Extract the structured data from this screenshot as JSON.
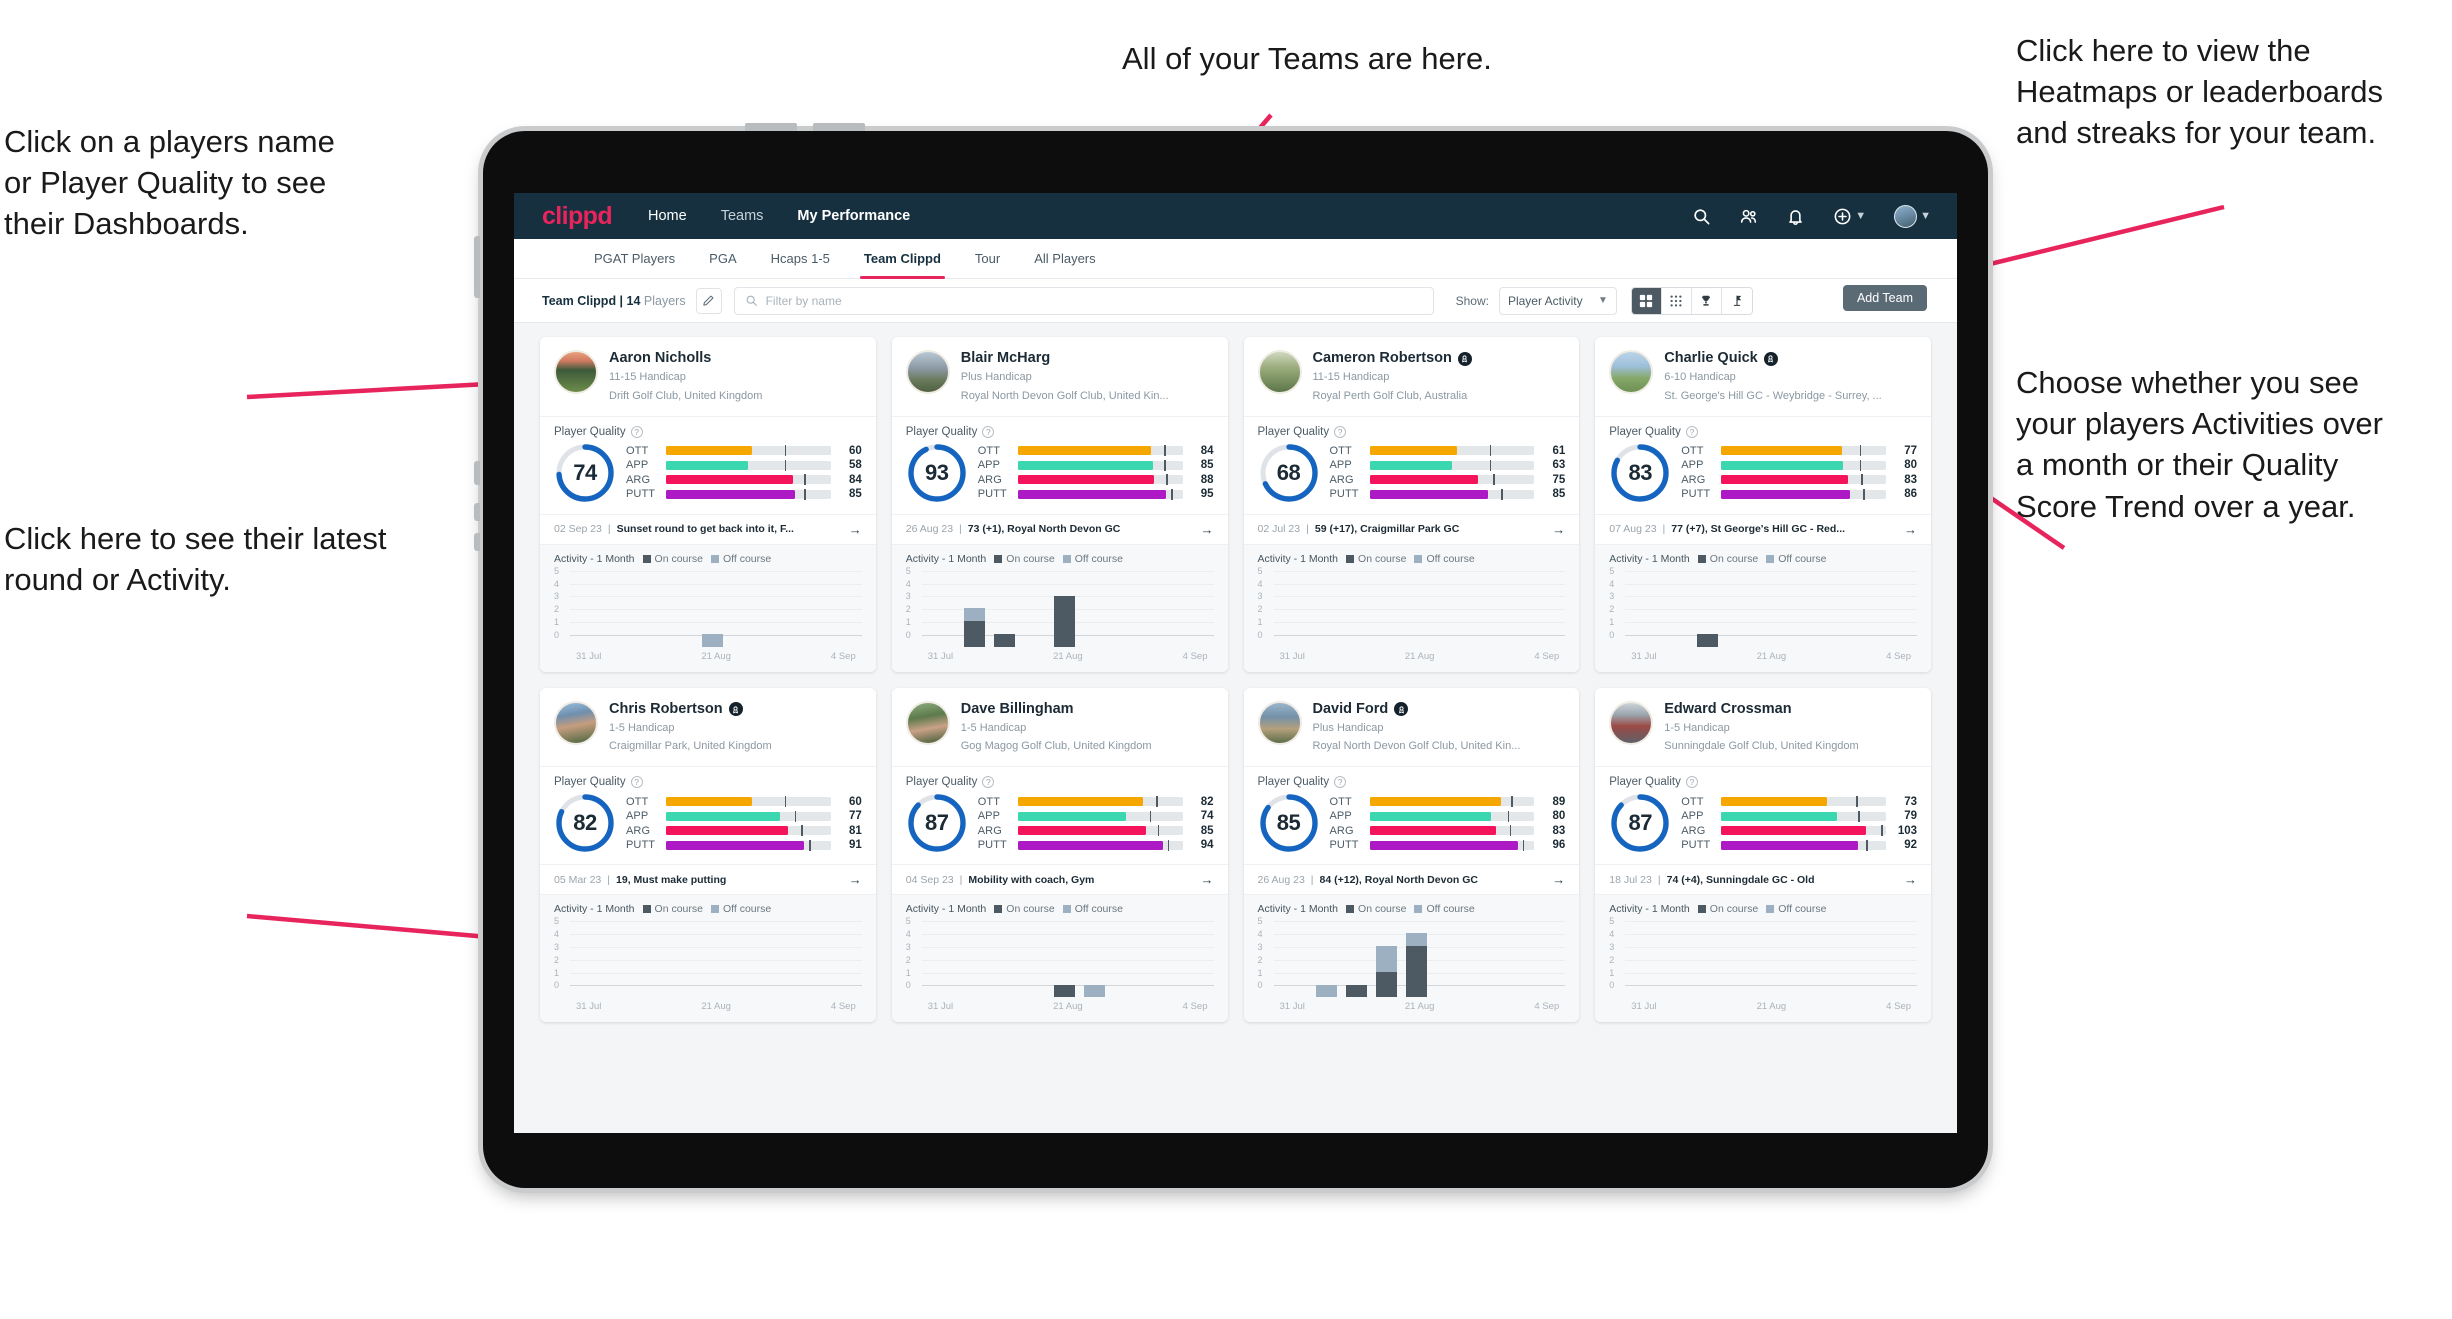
{
  "annotations": [
    {
      "id": "teams-note",
      "text": "All of your Teams are here."
    },
    {
      "id": "heatmaps-note",
      "text": "Click here to view the\nHeatmaps or leaderboards\nand streaks for your team."
    },
    {
      "id": "dashboard-note",
      "text": "Click on a players name\nor Player Quality to see\ntheir Dashboards."
    },
    {
      "id": "activity-note",
      "text": "Choose whether you see\nyour players Activities over\na month or their Quality\nScore Trend over a year."
    },
    {
      "id": "latest-note",
      "text": "Click here to see their latest\nround or Activity."
    }
  ],
  "colors": {
    "accent": "#e8245c",
    "topbar": "#16303f",
    "ring": "#1565c0",
    "ott": "#f5a700",
    "app": "#3ad7b0",
    "arg": "#f4145b",
    "putt": "#ad19c4",
    "on_course": "#4d5a63",
    "off_course": "#9db0c2"
  },
  "header": {
    "brand": "clippd",
    "nav": [
      {
        "label": "Home",
        "active": false
      },
      {
        "label": "Teams",
        "active": false
      },
      {
        "label": "My Performance",
        "active": true
      }
    ],
    "icons": [
      "search-icon",
      "people-icon",
      "bell-icon",
      "plus-circle-icon",
      "avatar"
    ]
  },
  "tabs": [
    {
      "label": "PGAT Players",
      "active": false
    },
    {
      "label": "PGA",
      "active": false
    },
    {
      "label": "Hcaps 1-5",
      "active": false
    },
    {
      "label": "Team Clippd",
      "active": true
    },
    {
      "label": "Tour",
      "active": false
    },
    {
      "label": "All Players",
      "active": false
    }
  ],
  "add_team_button": "Add Team",
  "toolbar": {
    "team_label_bold": "Team Clippd | 14",
    "team_label_rest": " Players",
    "search_placeholder": "Filter by name",
    "show_label": "Show:",
    "show_value": "Player Activity",
    "view_modes": [
      "grid-large-icon",
      "grid-small-icon",
      "trophy-icon",
      "flag-icon"
    ],
    "active_view": 0
  },
  "card_labels": {
    "player_quality": "Player Quality",
    "activity": "Activity - 1 Month",
    "on_course": "On course",
    "off_course": "Off course",
    "metrics": [
      "OTT",
      "APP",
      "ARG",
      "PUTT"
    ],
    "y_ticks": [
      "5",
      "4",
      "3",
      "2",
      "1",
      "0"
    ],
    "x_ticks": [
      "31 Jul",
      "21 Aug",
      "4 Sep"
    ]
  },
  "players": [
    {
      "name": "Aaron Nicholls",
      "verified": false,
      "avatar": "av1",
      "handicap": "11-15 Handicap",
      "club": "Drift Golf Club, United Kingdom",
      "quality": 74,
      "metrics": [
        {
          "key": "OTT",
          "value": 60,
          "fill": 52,
          "tick": 72
        },
        {
          "key": "APP",
          "value": 58,
          "fill": 50,
          "tick": 72
        },
        {
          "key": "ARG",
          "value": 84,
          "fill": 77,
          "tick": 84
        },
        {
          "key": "PUTT",
          "value": 85,
          "fill": 78,
          "tick": 84
        }
      ],
      "latest_date": "02 Sep 23",
      "latest_text": "Sunset round to get back into it, F...",
      "activity": [
        {
          "on": 0,
          "off": 0
        },
        {
          "on": 0,
          "off": 0
        },
        {
          "on": 0,
          "off": 0
        },
        {
          "on": 0,
          "off": 0
        },
        {
          "on": 0,
          "off": 1
        },
        {
          "on": 0,
          "off": 0
        }
      ]
    },
    {
      "name": "Blair McHarg",
      "verified": false,
      "avatar": "av2",
      "handicap": "Plus Handicap",
      "club": "Royal North Devon Golf Club, United Kin...",
      "quality": 93,
      "metrics": [
        {
          "key": "OTT",
          "value": 84,
          "fill": 81,
          "tick": 89
        },
        {
          "key": "APP",
          "value": 85,
          "fill": 82,
          "tick": 89
        },
        {
          "key": "ARG",
          "value": 88,
          "fill": 83,
          "tick": 90
        },
        {
          "key": "PUTT",
          "value": 95,
          "fill": 90,
          "tick": 93
        }
      ],
      "latest_date": "26 Aug 23",
      "latest_text": "73 (+1), Royal North Devon GC",
      "activity": [
        {
          "on": 0,
          "off": 0
        },
        {
          "on": 2,
          "off": 1
        },
        {
          "on": 1,
          "off": 0
        },
        {
          "on": 0,
          "off": 0
        },
        {
          "on": 4,
          "off": 0
        },
        {
          "on": 0,
          "off": 0
        }
      ]
    },
    {
      "name": "Cameron Robertson",
      "verified": true,
      "avatar": "av3",
      "handicap": "11-15 Handicap",
      "club": "Royal Perth Golf Club, Australia",
      "quality": 68,
      "metrics": [
        {
          "key": "OTT",
          "value": 61,
          "fill": 53,
          "tick": 73
        },
        {
          "key": "APP",
          "value": 63,
          "fill": 50,
          "tick": 73
        },
        {
          "key": "ARG",
          "value": 75,
          "fill": 66,
          "tick": 75
        },
        {
          "key": "PUTT",
          "value": 85,
          "fill": 72,
          "tick": 80
        }
      ],
      "latest_date": "02 Jul 23",
      "latest_text": "59 (+17), Craigmillar Park GC",
      "activity": [
        {
          "on": 0,
          "off": 0
        },
        {
          "on": 0,
          "off": 0
        },
        {
          "on": 0,
          "off": 0
        },
        {
          "on": 0,
          "off": 0
        },
        {
          "on": 0,
          "off": 0
        },
        {
          "on": 0,
          "off": 0
        }
      ]
    },
    {
      "name": "Charlie Quick",
      "verified": true,
      "avatar": "av4",
      "handicap": "6-10 Handicap",
      "club": "St. George's Hill GC - Weybridge - Surrey, ...",
      "quality": 83,
      "metrics": [
        {
          "key": "OTT",
          "value": 77,
          "fill": 73,
          "tick": 84
        },
        {
          "key": "APP",
          "value": 80,
          "fill": 74,
          "tick": 84
        },
        {
          "key": "ARG",
          "value": 83,
          "fill": 77,
          "tick": 85
        },
        {
          "key": "PUTT",
          "value": 86,
          "fill": 78,
          "tick": 86
        }
      ],
      "latest_date": "07 Aug 23",
      "latest_text": "77 (+7), St George's Hill GC - Red...",
      "activity": [
        {
          "on": 0,
          "off": 0
        },
        {
          "on": 0,
          "off": 0
        },
        {
          "on": 1,
          "off": 0
        },
        {
          "on": 0,
          "off": 0
        },
        {
          "on": 0,
          "off": 0
        },
        {
          "on": 0,
          "off": 0
        }
      ]
    },
    {
      "name": "Chris Robertson",
      "verified": true,
      "avatar": "av5",
      "handicap": "1-5 Handicap",
      "club": "Craigmillar Park, United Kingdom",
      "quality": 82,
      "metrics": [
        {
          "key": "OTT",
          "value": 60,
          "fill": 52,
          "tick": 72
        },
        {
          "key": "APP",
          "value": 77,
          "fill": 69,
          "tick": 78
        },
        {
          "key": "ARG",
          "value": 81,
          "fill": 74,
          "tick": 82
        },
        {
          "key": "PUTT",
          "value": 91,
          "fill": 84,
          "tick": 87
        }
      ],
      "latest_date": "05 Mar 23",
      "latest_text": "19, Must make putting",
      "activity": [
        {
          "on": 0,
          "off": 0
        },
        {
          "on": 0,
          "off": 0
        },
        {
          "on": 0,
          "off": 0
        },
        {
          "on": 0,
          "off": 0
        },
        {
          "on": 0,
          "off": 0
        },
        {
          "on": 0,
          "off": 0
        }
      ]
    },
    {
      "name": "Dave Billingham",
      "verified": false,
      "avatar": "av6",
      "handicap": "1-5 Handicap",
      "club": "Gog Magog Golf Club, United Kingdom",
      "quality": 87,
      "metrics": [
        {
          "key": "OTT",
          "value": 82,
          "fill": 76,
          "tick": 84
        },
        {
          "key": "APP",
          "value": 74,
          "fill": 66,
          "tick": 80
        },
        {
          "key": "ARG",
          "value": 85,
          "fill": 78,
          "tick": 85
        },
        {
          "key": "PUTT",
          "value": 94,
          "fill": 88,
          "tick": 91
        }
      ],
      "latest_date": "04 Sep 23",
      "latest_text": "Mobility with coach, Gym",
      "activity": [
        {
          "on": 0,
          "off": 0
        },
        {
          "on": 0,
          "off": 0
        },
        {
          "on": 0,
          "off": 0
        },
        {
          "on": 0,
          "off": 0
        },
        {
          "on": 1,
          "off": 0
        },
        {
          "on": 0,
          "off": 1
        }
      ]
    },
    {
      "name": "David Ford",
      "verified": true,
      "avatar": "av7",
      "handicap": "Plus Handicap",
      "club": "Royal North Devon Golf Club, United Kin...",
      "quality": 85,
      "metrics": [
        {
          "key": "OTT",
          "value": 89,
          "fill": 80,
          "tick": 86
        },
        {
          "key": "APP",
          "value": 80,
          "fill": 74,
          "tick": 84
        },
        {
          "key": "ARG",
          "value": 83,
          "fill": 77,
          "tick": 85
        },
        {
          "key": "PUTT",
          "value": 96,
          "fill": 90,
          "tick": 93
        }
      ],
      "latest_date": "26 Aug 23",
      "latest_text": "84 (+12), Royal North Devon GC",
      "activity": [
        {
          "on": 0,
          "off": 0
        },
        {
          "on": 0,
          "off": 1
        },
        {
          "on": 1,
          "off": 0
        },
        {
          "on": 2,
          "off": 2
        },
        {
          "on": 4,
          "off": 1
        },
        {
          "on": 0,
          "off": 0
        }
      ]
    },
    {
      "name": "Edward Crossman",
      "verified": false,
      "avatar": "av8",
      "handicap": "1-5 Handicap",
      "club": "Sunningdale Golf Club, United Kingdom",
      "quality": 87,
      "metrics": [
        {
          "key": "OTT",
          "value": 73,
          "fill": 64,
          "tick": 82
        },
        {
          "key": "APP",
          "value": 79,
          "fill": 70,
          "tick": 83
        },
        {
          "key": "ARG",
          "value": 103,
          "fill": 88,
          "tick": 97
        },
        {
          "key": "PUTT",
          "value": 92,
          "fill": 83,
          "tick": 88
        }
      ],
      "latest_date": "18 Jul 23",
      "latest_text": "74 (+4), Sunningdale GC - Old",
      "activity": [
        {
          "on": 0,
          "off": 0
        },
        {
          "on": 0,
          "off": 0
        },
        {
          "on": 0,
          "off": 0
        },
        {
          "on": 0,
          "off": 0
        },
        {
          "on": 0,
          "off": 0
        },
        {
          "on": 0,
          "off": 0
        }
      ]
    }
  ]
}
